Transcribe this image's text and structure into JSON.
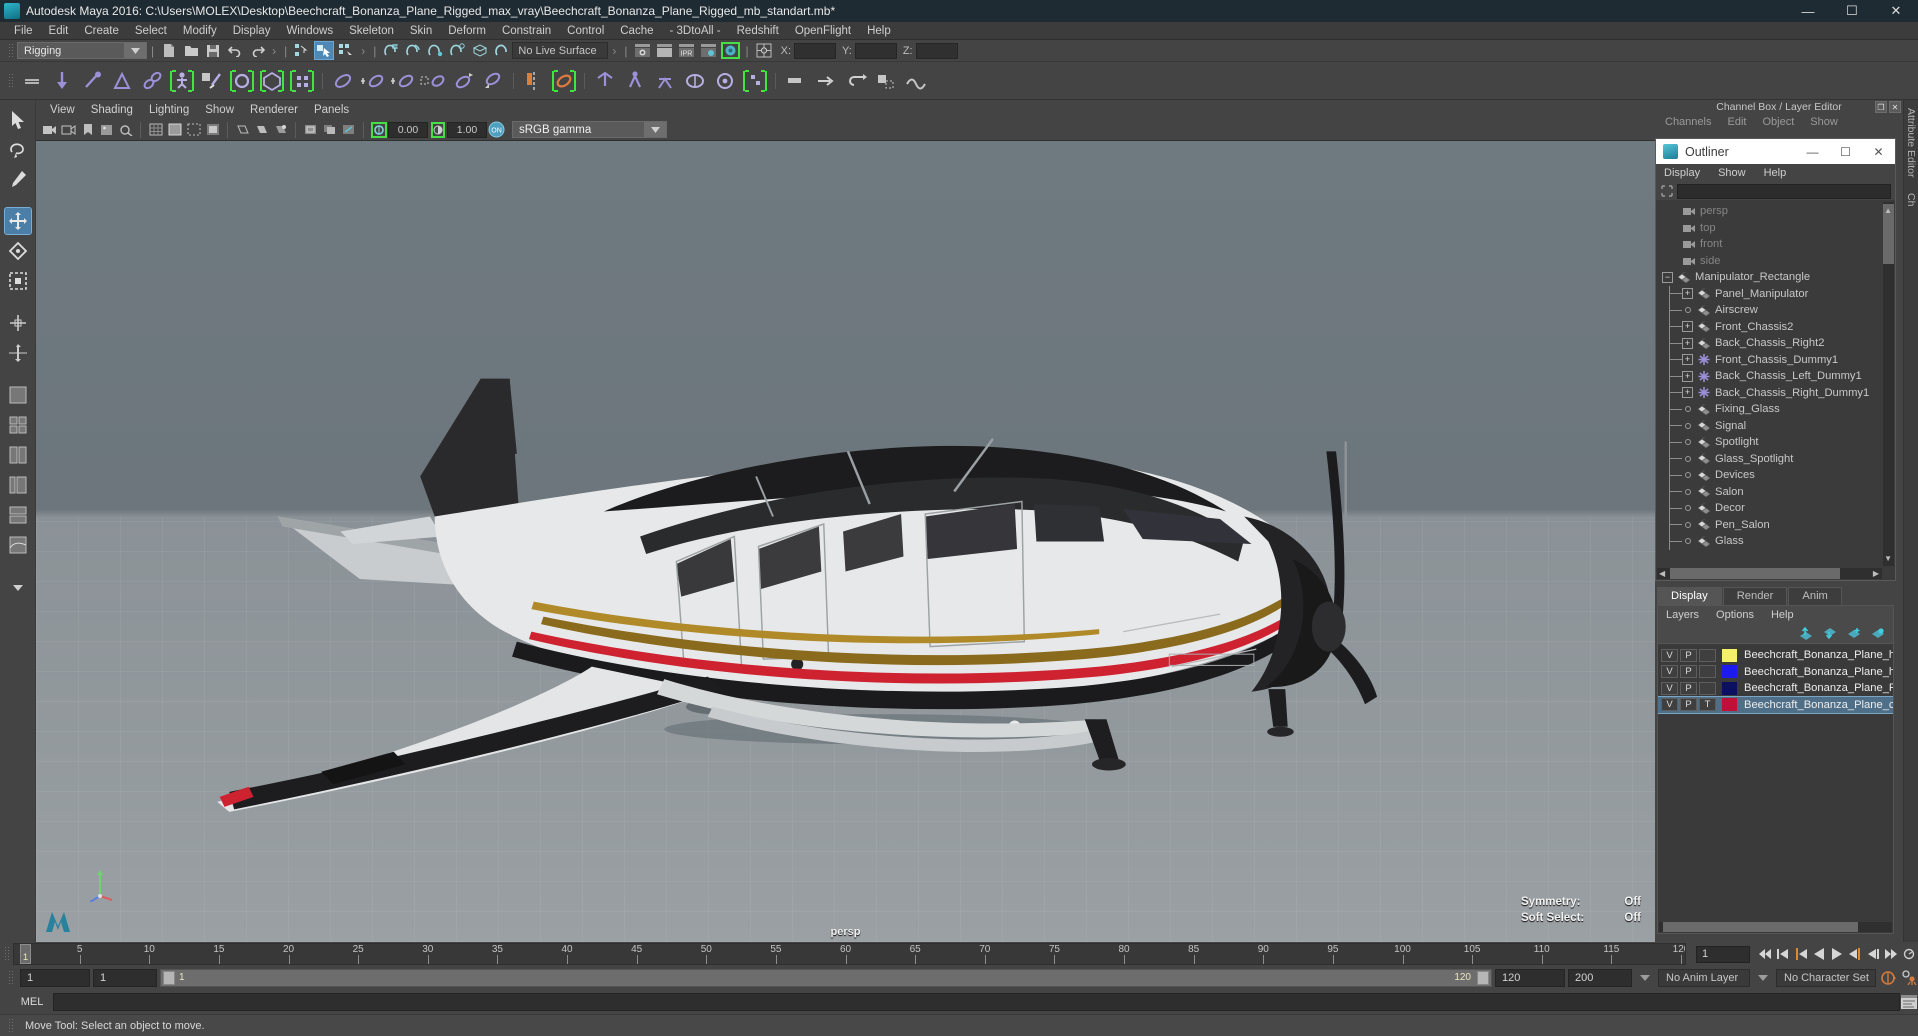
{
  "window": {
    "title": "Autodesk Maya 2016: C:\\Users\\MOLEX\\Desktop\\Beechcraft_Bonanza_Plane_Rigged_max_vray\\Beechcraft_Bonanza_Plane_Rigged_mb_standart.mb*",
    "minimize": "—",
    "maximize": "☐",
    "close": "✕"
  },
  "menu": [
    "File",
    "Edit",
    "Create",
    "Select",
    "Modify",
    "Display",
    "Windows",
    "Skeleton",
    "Skin",
    "Deform",
    "Constrain",
    "Control",
    "Cache",
    "- 3DtoAll -",
    "Redshift",
    "OpenFlight",
    "Help"
  ],
  "status_toolbar": {
    "menu_set": "Rigging",
    "live_surface": "No Live Surface",
    "coord_labels": [
      "X:",
      "Y:",
      "Z:"
    ],
    "coord_values": [
      "",
      "",
      ""
    ]
  },
  "viewport_panel": {
    "menu": [
      "View",
      "Shading",
      "Lighting",
      "Show",
      "Renderer",
      "Panels"
    ],
    "exposure": "0.00",
    "gamma": "1.00",
    "color_space": "sRGB gamma",
    "view_label": "persp",
    "hud": [
      {
        "label": "Symmetry:",
        "value": "Off"
      },
      {
        "label": "Soft Select:",
        "value": "Off"
      }
    ]
  },
  "channel_box": {
    "title": "Channel Box / Layer Editor",
    "tabs": [
      "Channels",
      "Edit",
      "Object",
      "Show"
    ]
  },
  "outliner": {
    "title": "Outliner",
    "window_buttons": {
      "minimize": "—",
      "maximize": "☐",
      "close": "✕"
    },
    "menu": [
      "Display",
      "Show",
      "Help"
    ],
    "search_value": "",
    "items": [
      {
        "label": "persp",
        "type": "camera",
        "depth": 1,
        "toggle": "none"
      },
      {
        "label": "top",
        "type": "camera",
        "depth": 1,
        "toggle": "none"
      },
      {
        "label": "front",
        "type": "camera",
        "depth": 1,
        "toggle": "none"
      },
      {
        "label": "side",
        "type": "camera",
        "depth": 1,
        "toggle": "none"
      },
      {
        "label": "Manipulator_Rectangle",
        "type": "mesh",
        "depth": 0,
        "toggle": "minus"
      },
      {
        "label": "Panel_Manipulator",
        "type": "mesh",
        "depth": 1,
        "toggle": "plus"
      },
      {
        "label": "Airscrew",
        "type": "mesh",
        "depth": 1,
        "toggle": "dot"
      },
      {
        "label": "Front_Chassis2",
        "type": "mesh",
        "depth": 1,
        "toggle": "plus"
      },
      {
        "label": "Back_Chassis_Right2",
        "type": "mesh",
        "depth": 1,
        "toggle": "plus"
      },
      {
        "label": "Front_Chassis_Dummy1",
        "type": "locator",
        "depth": 1,
        "toggle": "plus"
      },
      {
        "label": "Back_Chassis_Left_Dummy1",
        "type": "locator",
        "depth": 1,
        "toggle": "plus"
      },
      {
        "label": "Back_Chassis_Right_Dummy1",
        "type": "locator",
        "depth": 1,
        "toggle": "plus"
      },
      {
        "label": "Fixing_Glass",
        "type": "mesh",
        "depth": 1,
        "toggle": "dot"
      },
      {
        "label": "Signal",
        "type": "mesh",
        "depth": 1,
        "toggle": "dot"
      },
      {
        "label": "Spotlight",
        "type": "mesh",
        "depth": 1,
        "toggle": "dot"
      },
      {
        "label": "Glass_Spotlight",
        "type": "mesh",
        "depth": 1,
        "toggle": "dot"
      },
      {
        "label": "Devices",
        "type": "mesh",
        "depth": 1,
        "toggle": "dot"
      },
      {
        "label": "Salon",
        "type": "mesh",
        "depth": 1,
        "toggle": "dot"
      },
      {
        "label": "Decor",
        "type": "mesh",
        "depth": 1,
        "toggle": "dot"
      },
      {
        "label": "Pen_Salon",
        "type": "mesh",
        "depth": 1,
        "toggle": "dot"
      },
      {
        "label": "Glass",
        "type": "mesh",
        "depth": 1,
        "toggle": "dot"
      }
    ]
  },
  "layer_editor": {
    "tabs": [
      "Display",
      "Render",
      "Anim"
    ],
    "selected_tab": "Display",
    "menu": [
      "Layers",
      "Options",
      "Help"
    ],
    "layers": [
      {
        "visibility": "V",
        "playback": "P",
        "third": "",
        "color": "#f5f06a",
        "name": "Beechcraft_Bonanza_Plane_he",
        "selected": false
      },
      {
        "visibility": "V",
        "playback": "P",
        "third": "",
        "color": "#1b1bf0",
        "name": "Beechcraft_Bonanza_Plane_he",
        "selected": false
      },
      {
        "visibility": "V",
        "playback": "P",
        "third": "",
        "color": "#0b1060",
        "name": "Beechcraft_Bonanza_Plane_Rig",
        "selected": false
      },
      {
        "visibility": "V",
        "playback": "P",
        "third": "T",
        "color": "#c01038",
        "name": "Beechcraft_Bonanza_Plane_co",
        "selected": true
      }
    ]
  },
  "vertical_tabs": [
    "Attribute Editor",
    "Ch"
  ],
  "timeline": {
    "start": 1,
    "end": 120,
    "current_frame": "1",
    "tick_labels": [
      "5",
      "10",
      "15",
      "20",
      "25",
      "30",
      "35",
      "40",
      "45",
      "50",
      "55",
      "60",
      "65",
      "70",
      "75",
      "80",
      "85",
      "90",
      "95",
      "100",
      "105",
      "110",
      "115",
      "120"
    ],
    "current_marker_label": "1",
    "playback_buttons": [
      "go-to-start",
      "step-back-key",
      "step-back-frame",
      "play-backwards",
      "play-forwards",
      "step-forward-frame",
      "step-forward-key",
      "go-to-end"
    ]
  },
  "range_slider": {
    "anim_start": "1",
    "range_start": "1",
    "bar_label": "1",
    "bar_end_label": "120",
    "range_end": "120",
    "anim_end": "200",
    "anim_layer": "No Anim Layer",
    "character_set": "No Character Set"
  },
  "command_line": {
    "language": "MEL",
    "value": ""
  },
  "status_bar": {
    "message": "Move Tool: Select an object to move."
  }
}
